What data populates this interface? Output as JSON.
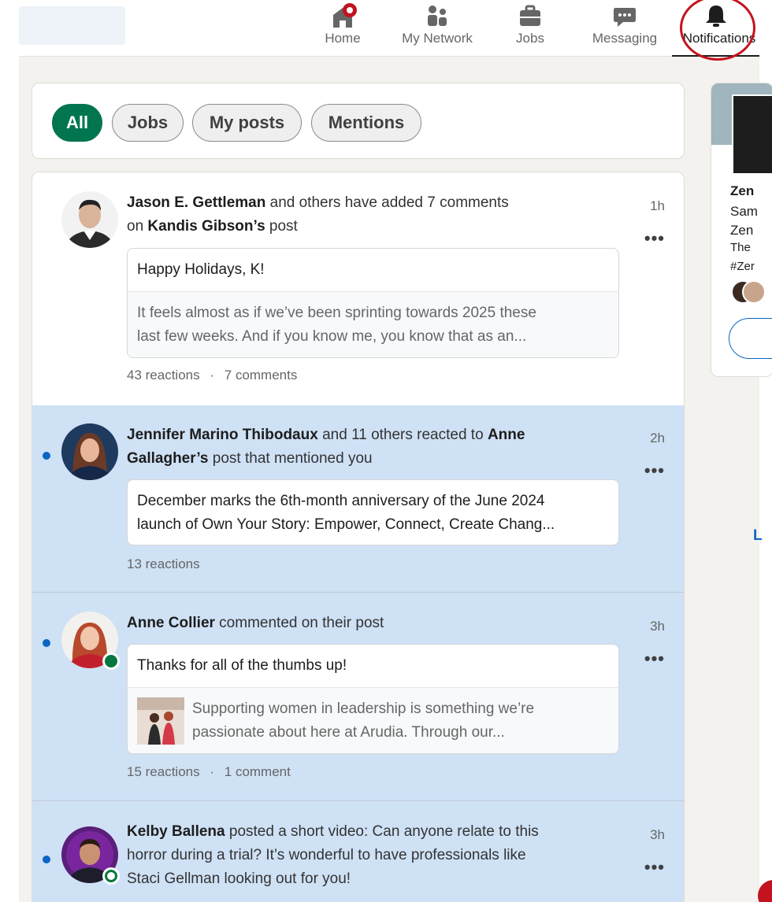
{
  "nav": {
    "home": "Home",
    "network": "My Network",
    "jobs": "Jobs",
    "messaging": "Messaging",
    "notifications": "Notifications"
  },
  "filters": [
    "All",
    "Jobs",
    "My posts",
    "Mentions"
  ],
  "notifications": [
    {
      "actor": "Jason E. Gettleman",
      "text_1": " and others have added 7 comments",
      "text_2": "on ",
      "target": "Kandis Gibson’s",
      "text_3": " post",
      "time": "1h",
      "quote_title": "Happy Holidays, K!",
      "quote_body_1": "It feels almost as if we’ve been sprinting towards 2025 these",
      "quote_body_2": "last few weeks. And if you know me, you know that as an...",
      "reactions": "43 reactions",
      "comments": "7 comments"
    },
    {
      "actor": "Jennifer Marino Thibodaux",
      "text_1": " and 11 others reacted to ",
      "target_1": "Anne",
      "target_2": "Gallagher’s",
      "text_2": " post that mentioned you",
      "time": "2h",
      "quote_1": "December marks the 6th-month anniversary of the June 2024",
      "quote_2": "launch of Own Your Story: Empower, Connect, Create Chang...",
      "reactions": "13 reactions"
    },
    {
      "actor": "Anne Collier",
      "text_1": " commented on their post",
      "time": "3h",
      "quote_title": "Thanks for all of the thumbs up!",
      "quote_body_1": "Supporting women in leadership is something we’re",
      "quote_body_2": "passionate about here at Arudia. Through our...",
      "reactions": "15 reactions",
      "comments": "1 comment"
    },
    {
      "actor": "Kelby Ballena",
      "text_1": " posted a short video: Can anyone relate to this",
      "text_2": "horror during a trial? It’s wonderful to have professionals like",
      "text_3": "Staci Gellman looking out for you!",
      "time": "3h"
    }
  ],
  "side": {
    "l1": "Zen",
    "l2": "Sam",
    "l3": "Zen",
    "l4": "The",
    "l5": "#Zer",
    "link": "L"
  },
  "colors": {
    "accent": "#01754f",
    "unread_bg": "#cfe1f5",
    "link": "#0a66c2",
    "annotation": "#c4121f"
  }
}
